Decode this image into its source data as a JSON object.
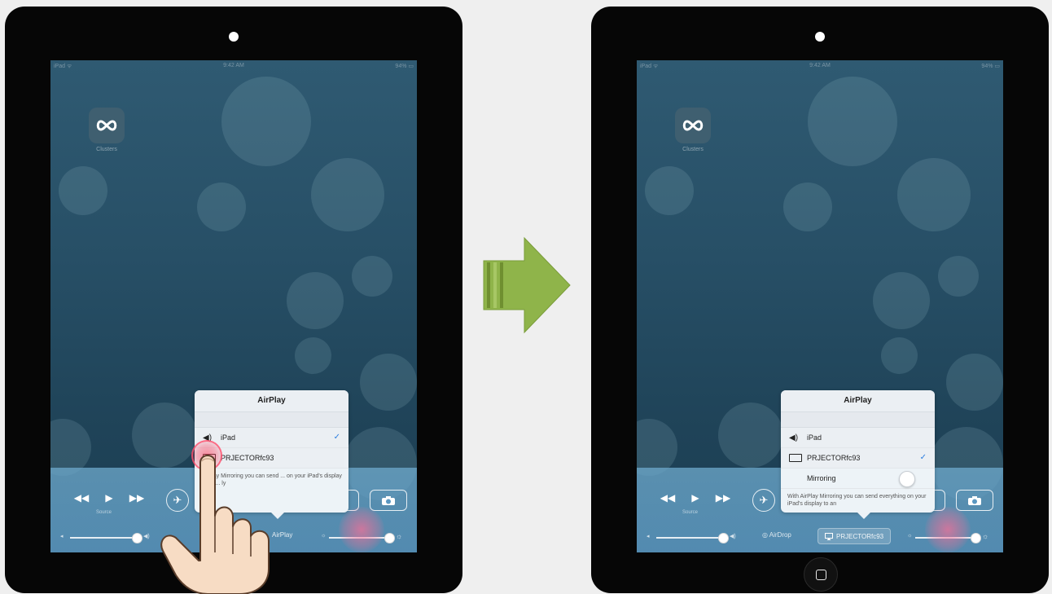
{
  "status_bar": {
    "carrier": "iPad ᯤ",
    "time": "9:42 AM",
    "battery": "94% ▭"
  },
  "home_screen": {
    "app_label": "Clusters"
  },
  "control_center": {
    "source_label": "Source",
    "airdrop_label": "AirDrop",
    "airplay_label_left": "AirPlay",
    "airplay_label_right": "PRJECTORfc93"
  },
  "popover_left": {
    "title": "AirPlay",
    "rows": [
      {
        "label": "iPad",
        "icon": "speaker-icon",
        "checked": true
      },
      {
        "label": "PRJECTORfc93",
        "icon": "tv-icon",
        "checked": false
      }
    ],
    "description": "AirPlay Mirroring you can send ... on your iPad's display to an ... ly"
  },
  "popover_right": {
    "title": "AirPlay",
    "rows": [
      {
        "label": "iPad",
        "icon": "speaker-icon",
        "checked": false
      },
      {
        "label": "PRJECTORfc93",
        "icon": "tv-icon",
        "checked": true
      },
      {
        "label": "Mirroring",
        "icon": "toggle",
        "checked": false
      }
    ],
    "description": "With AirPlay Mirroring you can send everything on your iPad's display to an"
  },
  "colors": {
    "ipad_bezel": "#060606",
    "arrow_green": "#8fb44a",
    "checkmark_blue": "#2b7ddf",
    "control_center_blue": "#6aa8cf"
  },
  "glyphs": {
    "speaker": "◀)",
    "check": "✓",
    "rewind": "◀◀",
    "play": "▶",
    "forward": "▶▶",
    "airplane": "✈",
    "volume_low": "◂",
    "volume_high": "◀)",
    "brightness_low": "☼",
    "brightness_high": "☼",
    "airdrop": "◎"
  }
}
